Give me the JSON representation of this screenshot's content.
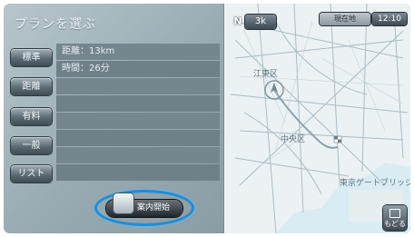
{
  "panel": {
    "title": "プランを選ぶ",
    "buttons": [
      {
        "label": "標準"
      },
      {
        "label": "距離"
      },
      {
        "label": "有料"
      },
      {
        "label": "一般"
      },
      {
        "label": "リスト"
      }
    ],
    "rows": [
      "距離：13km",
      "時間：26分",
      "",
      "",
      "",
      "",
      "",
      ""
    ],
    "guide_button_label": "案内開始"
  },
  "map": {
    "north": "N",
    "scale": "3k",
    "place_chip": "現在地",
    "clock": "12:10",
    "labels": [
      "江東区",
      "東京ゲートブリッジ",
      "中央区"
    ],
    "back_label": "もどる"
  },
  "colors": {
    "highlight_ring": "#1c8ed9",
    "water": "#d9ecf4",
    "panel": "#98aab2"
  }
}
